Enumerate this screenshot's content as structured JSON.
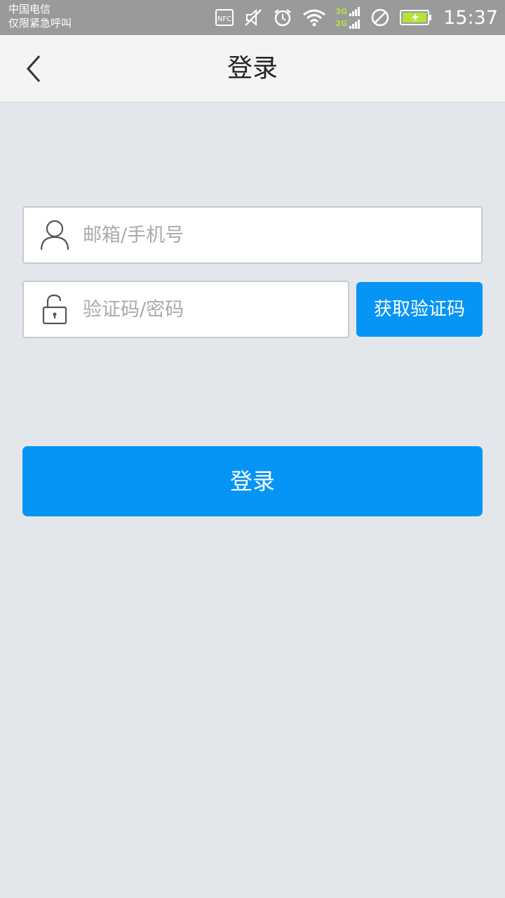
{
  "status_bar": {
    "carrier_line1": "中国电信",
    "carrier_line2": "仅限紧急呼叫",
    "net_3g": "3G",
    "net_2g": "2G",
    "time": "15:37",
    "icons": [
      "nfc-icon",
      "vibrate-off-icon",
      "alarm-icon",
      "wifi-icon",
      "signal-icon",
      "do-not-disturb-icon",
      "battery-charging-icon"
    ]
  },
  "nav": {
    "title": "登录",
    "back_icon": "chevron-left-icon"
  },
  "form": {
    "account_placeholder": "邮箱/手机号",
    "account_value": "",
    "account_icon": "user-icon",
    "password_placeholder": "验证码/密码",
    "password_value": "",
    "password_icon": "unlock-icon",
    "get_code_label": "获取验证码",
    "login_label": "登录"
  },
  "colors": {
    "accent": "#0695f5",
    "background": "#e3e7eb",
    "navbar": "#f4f4f4",
    "status_bar": "#9a9a9a"
  }
}
